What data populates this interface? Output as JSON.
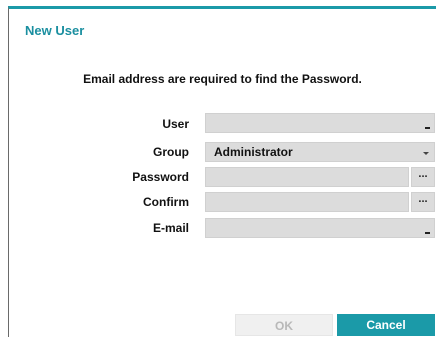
{
  "dialog": {
    "title": "New User",
    "notice": "Email address are required to find the Password."
  },
  "form": {
    "user_label": "User",
    "user_value": "",
    "group_label": "Group",
    "group_value": "Administrator",
    "password_label": "Password",
    "password_value": "",
    "password_button": "...",
    "confirm_label": "Confirm",
    "confirm_value": "",
    "confirm_button": "...",
    "email_label": "E-mail",
    "email_value": ""
  },
  "buttons": {
    "ok_label": "OK",
    "cancel_label": "Cancel"
  },
  "colors": {
    "accent": "#1b9aa8",
    "field_bg": "#dcdcdc"
  }
}
